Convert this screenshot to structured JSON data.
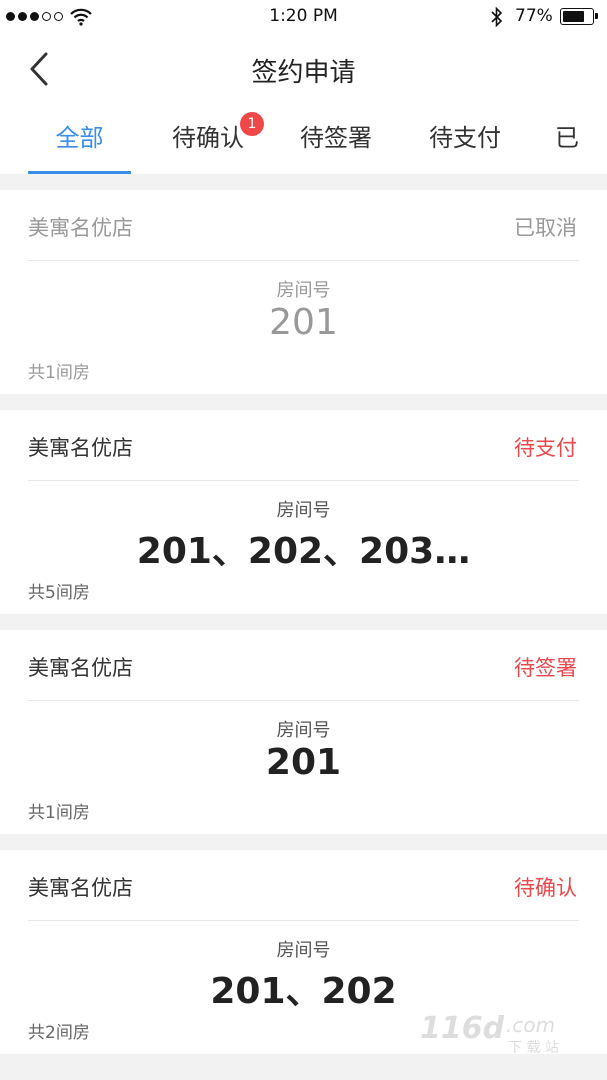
{
  "status_bar": {
    "time": "1:20 PM",
    "battery": "77%",
    "battery_level": 0.77
  },
  "nav": {
    "title": "签约申请"
  },
  "tabs": [
    {
      "label": "全部",
      "active": true
    },
    {
      "label": "待确认",
      "badge": "1"
    },
    {
      "label": "待签署"
    },
    {
      "label": "待支付"
    },
    {
      "label": "已"
    }
  ],
  "room_label": "房间号",
  "orders": [
    {
      "hotel": "美寓名优店",
      "status": "已取消",
      "rooms": "201",
      "count": "共1间房"
    },
    {
      "hotel": "美寓名优店",
      "status": "待支付",
      "rooms": "201、202、203…",
      "count": "共5间房"
    },
    {
      "hotel": "美寓名优店",
      "status": "待签署",
      "rooms": "201",
      "count": "共1间房"
    },
    {
      "hotel": "美寓名优店",
      "status": "待确认",
      "rooms": "201、202",
      "count": "共2间房"
    }
  ],
  "watermark": {
    "brand": "116d.com",
    "sub": "下载站"
  },
  "colors": {
    "accent": "#3a8ee6",
    "status_red": "#e8494b",
    "badge": "#f04848"
  }
}
